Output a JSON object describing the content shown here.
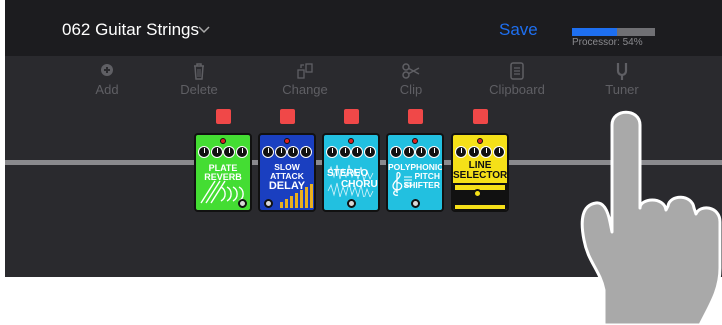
{
  "header": {
    "preset_name": "062 Guitar Strings",
    "save_label": "Save",
    "processor_label": "Processor: 54%",
    "processor_fraction": 0.54
  },
  "toolbar": [
    {
      "label": "Add",
      "icon": "plus-circle-icon"
    },
    {
      "label": "Delete",
      "icon": "trash-icon"
    },
    {
      "label": "Change",
      "icon": "swap-icon"
    },
    {
      "label": "Clip",
      "icon": "scissors-icon"
    },
    {
      "label": "Clipboard",
      "icon": "clipboard-icon"
    },
    {
      "label": "Tuner",
      "icon": "tuning-fork-icon"
    }
  ],
  "pedals": [
    {
      "title": "PLATE\nREVERB",
      "color": "#44dd33",
      "icon": "plate-reverb-icon"
    },
    {
      "title": "SLOW ATTACK\nDELAY",
      "color": "#1a3fc0",
      "icon": "slow-attack-delay-icon"
    },
    {
      "title": "STEREO\nCHORUS",
      "color": "#22c0e0",
      "icon": "stereo-chorus-icon"
    },
    {
      "title": "POLYPHONIC\nPITCH\nSHIFTER",
      "color": "#22c0e0",
      "icon": "polyphonic-pitch-shifter-icon"
    },
    {
      "title": "LINE\nSELECTOR",
      "color": "#f5e018",
      "icon": "line-selector-icon"
    }
  ],
  "colors": {
    "accent": "#1e6ff0",
    "bypass": "#f04848",
    "header_bg": "#1c1c1f",
    "panel_bg": "#2a2a2e"
  }
}
